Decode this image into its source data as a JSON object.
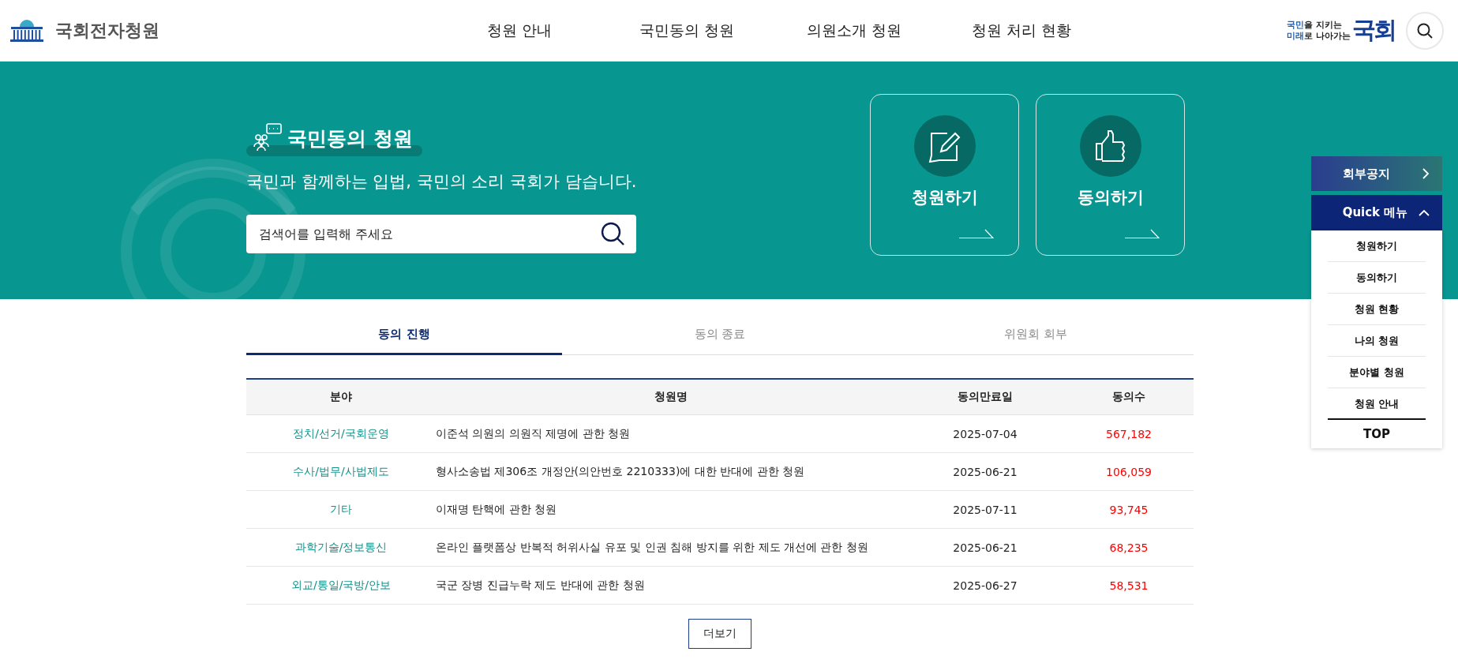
{
  "header": {
    "logo_text": "국회전자청원",
    "nav": [
      "청원 안내",
      "국민동의 청원",
      "의원소개 청원",
      "청원 처리 현황"
    ],
    "slogan": {
      "lines": [
        {
          "highlight": "국민",
          "rest": "을 지키는"
        },
        {
          "highlight": "미래",
          "rest": "로 나아가는"
        }
      ],
      "mark": "국회"
    }
  },
  "hero": {
    "title": "국민동의 청원",
    "subtitle": "국민과 함께하는 입법, 국민의 소리 국회가 담습니다.",
    "search": {
      "placeholder": "검색어를 입력해 주세요"
    },
    "cards": [
      {
        "label": "청원하기",
        "kind": "write"
      },
      {
        "label": "동의하기",
        "kind": "like"
      }
    ]
  },
  "tabs": [
    {
      "label": "동의 진행",
      "selected": true
    },
    {
      "label": "동의 종료",
      "selected": false
    },
    {
      "label": "위원회 회부",
      "selected": false
    }
  ],
  "table": {
    "columns": [
      "분야",
      "청원명",
      "동의만료일",
      "동의수"
    ],
    "rows": [
      [
        "정치/선거/국회운영",
        "이준석 의원의 의원직 제명에 관한 청원",
        "2025-07-04",
        "567,182"
      ],
      [
        "수사/법무/사법제도",
        "형사소송법 제306조 개정안(의안번호 2210333)에 대한 반대에 관한 청원",
        "2025-06-21",
        "106,059"
      ],
      [
        "기타",
        "이재명 탄핵에 관한 청원",
        "2025-07-11",
        "93,745"
      ],
      [
        "과학기술/정보통신",
        "온라인 플랫폼상 반복적 허위사실 유포 및 인권 침해 방지를 위한 제도 개선에 관한 청원",
        "2025-06-21",
        "68,235"
      ],
      [
        "외교/통일/국방/안보",
        "국군 장병 진급누락 제도 반대에 관한 청원",
        "2025-06-27",
        "58,531"
      ]
    ]
  },
  "more_button": "더보기",
  "quick_menu": {
    "notice": "회부공지",
    "title": "Quick 메뉴",
    "expanded": true,
    "items": [
      "청원하기",
      "동의하기",
      "청원 현황",
      "나의 청원",
      "분야별 청원",
      "청원 안내"
    ],
    "top": "TOP"
  }
}
